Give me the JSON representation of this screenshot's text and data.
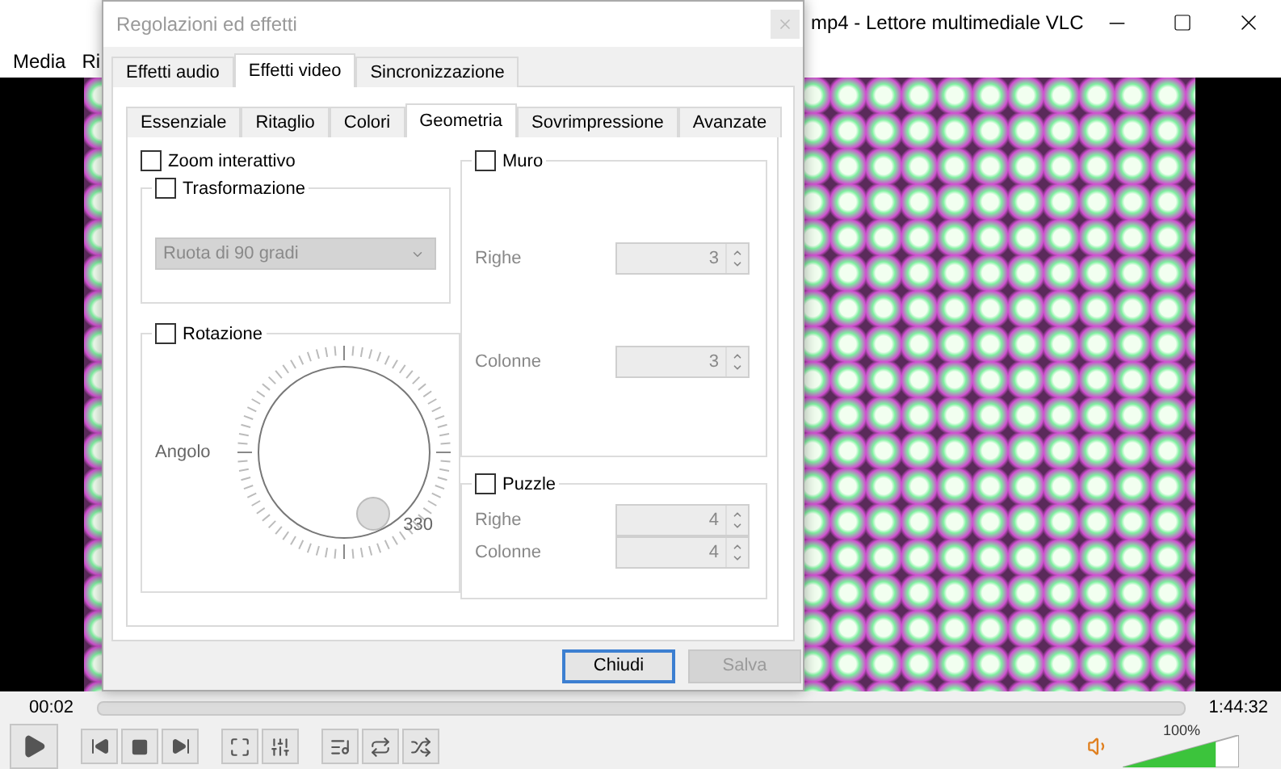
{
  "main_window": {
    "title": "mp4 - Lettore multimediale VLC",
    "menu": [
      "Media",
      "Ri"
    ]
  },
  "player": {
    "elapsed": "00:02",
    "duration": "1:44:32",
    "seek": {
      "level": 0.0
    },
    "volume": {
      "reading": "100%",
      "level": 0.8
    }
  },
  "dialog": {
    "title": "Regolazioni ed effetti",
    "tabs": [
      {
        "label": "Effetti audio",
        "selected": false
      },
      {
        "label": "Effetti video",
        "selected": true
      },
      {
        "label": "Sincronizzazione",
        "selected": false
      }
    ],
    "subtabs": [
      {
        "label": "Essenziale",
        "selected": false
      },
      {
        "label": "Ritaglio",
        "selected": false
      },
      {
        "label": "Colori",
        "selected": false
      },
      {
        "label": "Geometria",
        "selected": true
      },
      {
        "label": "Sovrimpressione",
        "selected": false
      },
      {
        "label": "Avanzate",
        "selected": false
      }
    ],
    "zoom": {
      "label": "Zoom interattivo",
      "checked": false
    },
    "transform": {
      "label": "Trasformazione",
      "checked": false,
      "dropdown": {
        "value": "Ruota di 90 gradi",
        "disabled": true
      }
    },
    "rotation": {
      "label": "Rotazione",
      "checked": false,
      "angle_label": "Angolo",
      "angle_value": "330"
    },
    "wall": {
      "label": "Muro",
      "checked": false,
      "fields": [
        {
          "label": "Righe",
          "value": "3",
          "disabled": true
        },
        {
          "label": "Colonne",
          "value": "3",
          "disabled": true
        }
      ]
    },
    "puzzle": {
      "label": "Puzzle",
      "checked": false,
      "fields": [
        {
          "label": "Righe",
          "value": "4",
          "disabled": true
        },
        {
          "label": "Colonne",
          "value": "4",
          "disabled": true
        }
      ]
    },
    "buttons": [
      {
        "label": "Chiudi",
        "default": true,
        "disabled": false
      },
      {
        "label": "Salva",
        "default": false,
        "disabled": true
      }
    ]
  }
}
